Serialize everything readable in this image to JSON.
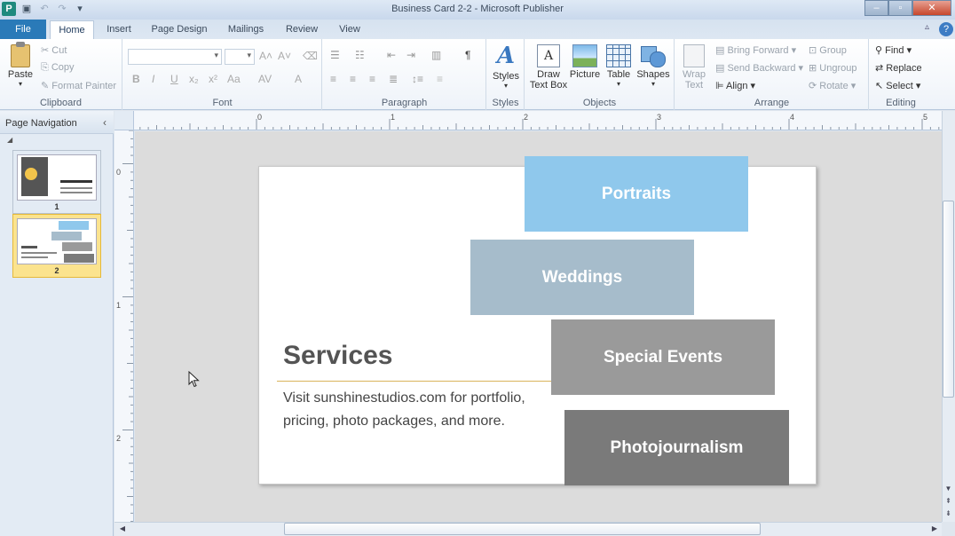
{
  "window": {
    "title": "Business Card 2-2  -  Microsoft Publisher",
    "app_icon": "P"
  },
  "tabs": {
    "file": "File",
    "items": [
      "Home",
      "Insert",
      "Page Design",
      "Mailings",
      "Review",
      "View"
    ]
  },
  "ribbon": {
    "clipboard": {
      "label": "Clipboard",
      "paste": "Paste",
      "cut": "Cut",
      "copy": "Copy",
      "format_painter": "Format Painter"
    },
    "font": {
      "label": "Font"
    },
    "paragraph": {
      "label": "Paragraph"
    },
    "styles": {
      "label": "Styles",
      "button": "Styles"
    },
    "objects": {
      "label": "Objects",
      "draw_text_box_1": "Draw",
      "draw_text_box_2": "Text Box",
      "picture": "Picture",
      "table": "Table",
      "shapes": "Shapes"
    },
    "arrange": {
      "label": "Arrange",
      "wrap_1": "Wrap",
      "wrap_2": "Text",
      "bring_forward": "Bring Forward",
      "send_backward": "Send Backward",
      "align": "Align",
      "group": "Group",
      "ungroup": "Ungroup",
      "rotate": "Rotate"
    },
    "editing": {
      "label": "Editing",
      "find": "Find",
      "replace": "Replace",
      "select": "Select"
    }
  },
  "nav": {
    "title": "Page Navigation",
    "pages": [
      {
        "number": "1",
        "selected": false
      },
      {
        "number": "2",
        "selected": true
      }
    ]
  },
  "ruler": {
    "top_labels": [
      "0",
      "1",
      "2",
      "3",
      "4",
      "5"
    ],
    "left_labels": [
      "0",
      "1",
      "2"
    ]
  },
  "card": {
    "boxes": [
      {
        "label": "Portraits",
        "color": "#8fc8ec"
      },
      {
        "label": "Weddings",
        "color": "#a6bccb"
      },
      {
        "label": "Special Events",
        "color": "#9a9a9a"
      },
      {
        "label": "Photojournalism",
        "color": "#7a7a7a"
      }
    ],
    "heading": "Services",
    "body": "Visit sunshinestudios.com for portfolio, pricing, photo packages, and more.",
    "rule_color": "#d9b45b"
  }
}
